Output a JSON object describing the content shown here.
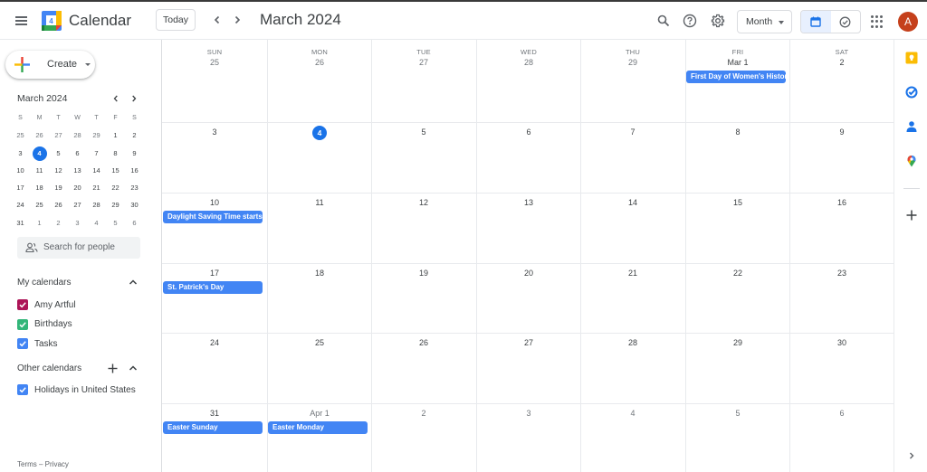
{
  "header": {
    "app_title": "Calendar",
    "logo_day": "4",
    "today_label": "Today",
    "period_title": "March 2024",
    "view_select": "Month",
    "avatar_initial": "A",
    "icons": [
      "menu-icon",
      "search-icon",
      "help-icon",
      "settings-icon",
      "calendar-view-icon",
      "tasks-view-icon",
      "apps-icon"
    ]
  },
  "sidebar": {
    "create_label": "Create",
    "mini_calendar": {
      "title": "March 2024",
      "weekdays": [
        "S",
        "M",
        "T",
        "W",
        "T",
        "F",
        "S"
      ],
      "weeks": [
        [
          "25",
          "26",
          "27",
          "28",
          "29",
          "1",
          "2"
        ],
        [
          "3",
          "4",
          "5",
          "6",
          "7",
          "8",
          "9"
        ],
        [
          "10",
          "11",
          "12",
          "13",
          "14",
          "15",
          "16"
        ],
        [
          "17",
          "18",
          "19",
          "20",
          "21",
          "22",
          "23"
        ],
        [
          "24",
          "25",
          "26",
          "27",
          "28",
          "29",
          "30"
        ],
        [
          "31",
          "1",
          "2",
          "3",
          "4",
          "5",
          "6"
        ]
      ],
      "today": "4"
    },
    "search_people_placeholder": "Search for people",
    "my_calendars": {
      "title": "My calendars",
      "items": [
        {
          "label": "Amy Artful",
          "color": "#ad1457",
          "checked": true
        },
        {
          "label": "Birthdays",
          "color": "#33b679",
          "checked": true
        },
        {
          "label": "Tasks",
          "color": "#4285f4",
          "checked": true
        }
      ]
    },
    "other_calendars": {
      "title": "Other calendars",
      "items": [
        {
          "label": "Holidays in United States",
          "color": "#4285f4",
          "checked": true
        }
      ]
    },
    "footer": "Terms – Privacy"
  },
  "month_grid": {
    "weekdays": [
      "SUN",
      "MON",
      "TUE",
      "WED",
      "THU",
      "FRI",
      "SAT"
    ],
    "weeks": [
      [
        {
          "date": "25",
          "other": true
        },
        {
          "date": "26",
          "other": true
        },
        {
          "date": "27",
          "other": true
        },
        {
          "date": "28",
          "other": true
        },
        {
          "date": "29",
          "other": true
        },
        {
          "date": "Mar 1",
          "events": [
            "First Day of Women's History Month"
          ]
        },
        {
          "date": "2"
        }
      ],
      [
        {
          "date": "3"
        },
        {
          "date": "4",
          "today": true
        },
        {
          "date": "5"
        },
        {
          "date": "6"
        },
        {
          "date": "7"
        },
        {
          "date": "8"
        },
        {
          "date": "9"
        }
      ],
      [
        {
          "date": "10",
          "events": [
            "Daylight Saving Time starts"
          ]
        },
        {
          "date": "11"
        },
        {
          "date": "12"
        },
        {
          "date": "13"
        },
        {
          "date": "14"
        },
        {
          "date": "15"
        },
        {
          "date": "16"
        }
      ],
      [
        {
          "date": "17",
          "events": [
            "St. Patrick's Day"
          ]
        },
        {
          "date": "18"
        },
        {
          "date": "19"
        },
        {
          "date": "20"
        },
        {
          "date": "21"
        },
        {
          "date": "22"
        },
        {
          "date": "23"
        }
      ],
      [
        {
          "date": "24"
        },
        {
          "date": "25"
        },
        {
          "date": "26"
        },
        {
          "date": "27"
        },
        {
          "date": "28"
        },
        {
          "date": "29"
        },
        {
          "date": "30"
        }
      ],
      [
        {
          "date": "31"
        },
        {
          "date": "Apr 1",
          "other": true,
          "events": [
            "Easter Monday"
          ]
        },
        {
          "date": "2",
          "other": true
        },
        {
          "date": "3",
          "other": true
        },
        {
          "date": "4",
          "other": true
        },
        {
          "date": "5",
          "other": true
        },
        {
          "date": "6",
          "other": true
        }
      ]
    ],
    "extra_events": {
      "31": "Easter Sunday"
    },
    "event_color": "#4285f4",
    "today_color": "#1a73e8"
  },
  "right_rail": {
    "icons": [
      "keep-icon",
      "tasks-icon",
      "contacts-icon",
      "maps-icon",
      "add-addon-icon",
      "expand-panel-icon"
    ]
  }
}
